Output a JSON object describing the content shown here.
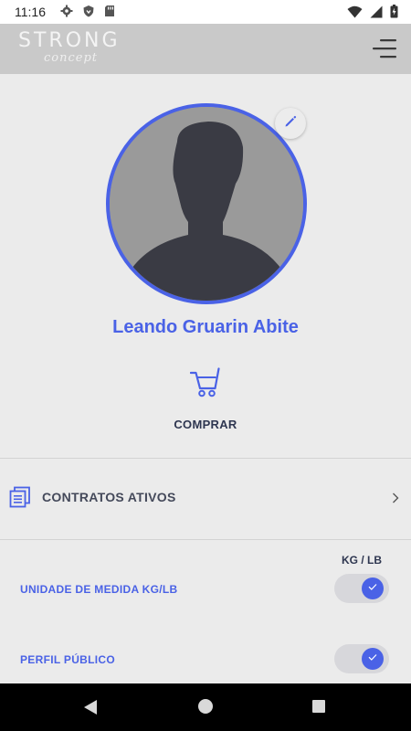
{
  "status_bar": {
    "time": "11:16",
    "icons_left": [
      "gear-icon",
      "shield-icon",
      "sd-card-icon"
    ],
    "icons_right": [
      "wifi-icon",
      "signal-icon",
      "battery-charging-icon"
    ]
  },
  "app_bar": {
    "logo_main": "STRONG",
    "logo_sub": "concept",
    "menu_icon": "menu-icon"
  },
  "profile": {
    "name": "Leando Gruarin Abite",
    "edit_icon": "pencil-icon",
    "avatar_icon": "user-silhouette-icon"
  },
  "actions": {
    "buy_label": "COMPRAR",
    "buy_icon": "cart-icon"
  },
  "contracts": {
    "label": "CONTRATOS ATIVOS",
    "icon": "documents-icon",
    "chevron_icon": "chevron-right-icon"
  },
  "settings": {
    "unit_header": "KG / LB",
    "items": [
      {
        "label": "UNIDADE DE MEDIDA KG/LB",
        "checked": true
      },
      {
        "label": "PERFIL PÚBLICO",
        "checked": true
      }
    ]
  },
  "nav_bar": {
    "icons": [
      "back-icon",
      "home-icon",
      "recents-icon"
    ]
  },
  "colors": {
    "accent": "#4a62e6",
    "background": "#ebebeb",
    "app_bar": "#c9c9c9",
    "nav_bar": "#000000"
  }
}
